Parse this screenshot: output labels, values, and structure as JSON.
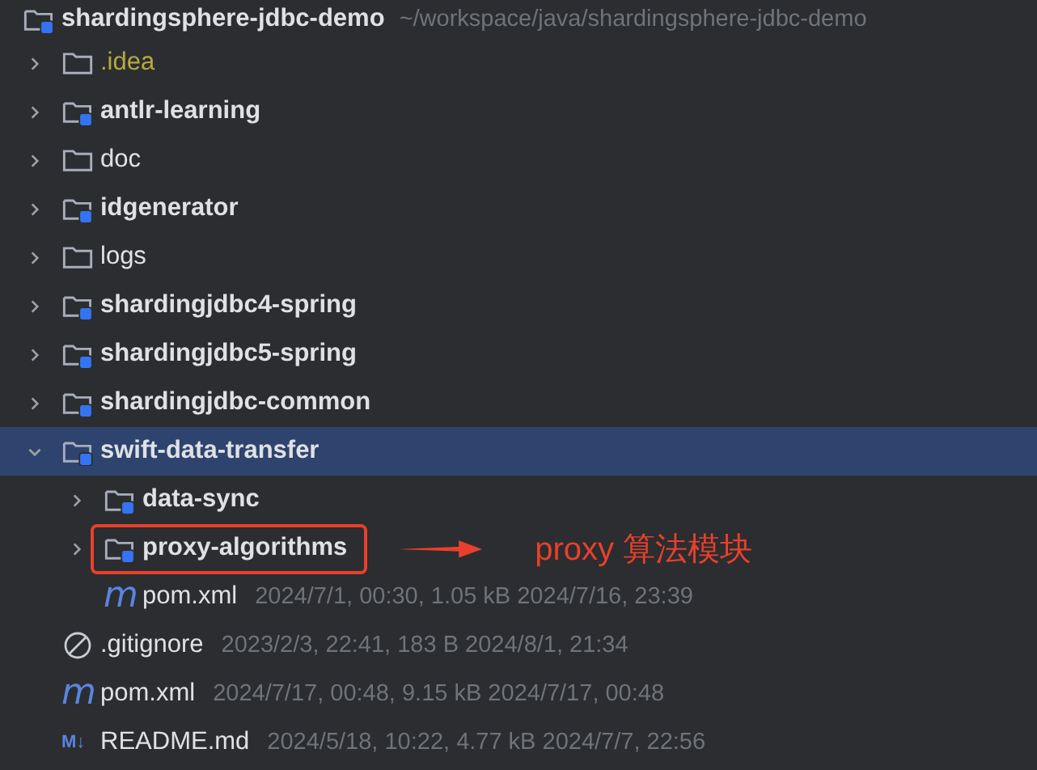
{
  "project_tree": {
    "root": {
      "name": "shardingsphere-jdbc-demo",
      "path": "~/workspace/java/shardingsphere-jdbc-demo",
      "kind": "module",
      "selected": false
    },
    "items": [
      {
        "name": ".idea",
        "kind": "folder",
        "expanded": false,
        "selected": false,
        "ignored": true,
        "annotated": false
      },
      {
        "name": "antlr-learning",
        "kind": "module",
        "expanded": false,
        "selected": false,
        "ignored": false,
        "annotated": false
      },
      {
        "name": "doc",
        "kind": "folder",
        "expanded": false,
        "selected": false,
        "ignored": false,
        "annotated": false
      },
      {
        "name": "idgenerator",
        "kind": "module",
        "expanded": false,
        "selected": false,
        "ignored": false,
        "annotated": false
      },
      {
        "name": "logs",
        "kind": "folder",
        "expanded": false,
        "selected": false,
        "ignored": false,
        "annotated": false
      },
      {
        "name": "shardingjdbc4-spring",
        "kind": "module",
        "expanded": false,
        "selected": false,
        "ignored": false,
        "annotated": false
      },
      {
        "name": "shardingjdbc5-spring",
        "kind": "module",
        "expanded": false,
        "selected": false,
        "ignored": false,
        "annotated": false
      },
      {
        "name": "shardingjdbc-common",
        "kind": "module",
        "expanded": false,
        "selected": false,
        "ignored": false,
        "annotated": false
      },
      {
        "name": "swift-data-transfer",
        "kind": "module",
        "expanded": true,
        "selected": true,
        "ignored": false,
        "annotated": false,
        "children": [
          {
            "name": "data-sync",
            "kind": "module",
            "expanded": false,
            "selected": false,
            "ignored": false,
            "annotated": false
          },
          {
            "name": "proxy-algorithms",
            "kind": "module",
            "expanded": false,
            "selected": false,
            "ignored": false,
            "annotated": true
          },
          {
            "name": "pom.xml",
            "kind": "glyph",
            "glyph": "m",
            "meta": "2024/7/1, 00:30, 1.05 kB 2024/7/16, 23:39",
            "selected": false,
            "ignored": false,
            "annotated": false
          }
        ]
      },
      {
        "name": ".gitignore",
        "kind": "ignore",
        "meta": "2023/2/3, 22:41, 183 B 2024/8/1, 21:34",
        "selected": false,
        "ignored": false,
        "annotated": false
      },
      {
        "name": "pom.xml",
        "kind": "glyph",
        "glyph": "m",
        "meta": "2024/7/17, 00:48, 9.15 kB 2024/7/17, 00:48",
        "selected": false,
        "ignored": false,
        "annotated": false
      },
      {
        "name": "README.md",
        "kind": "markdown",
        "glyph": "M↓",
        "meta": "2024/5/18, 10:22, 4.77 kB 2024/7/7, 22:56",
        "selected": false,
        "ignored": false,
        "annotated": false
      }
    ]
  },
  "annotation": {
    "text": "proxy 算法模块"
  }
}
